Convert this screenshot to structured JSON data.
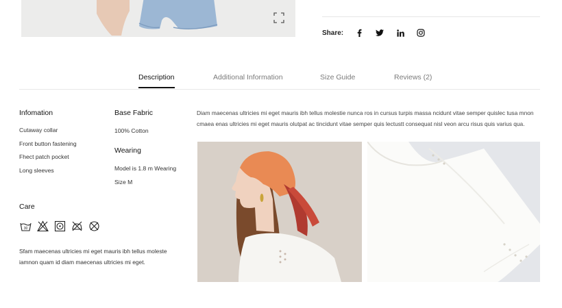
{
  "share": {
    "label": "Share:",
    "icons": [
      "facebook-icon",
      "twitter-icon",
      "linkedin-icon",
      "instagram-icon"
    ]
  },
  "tabs": [
    {
      "label": "Description",
      "active": true
    },
    {
      "label": "Additional Information",
      "active": false
    },
    {
      "label": "Size Guide",
      "active": false
    },
    {
      "label": "Reviews (2)",
      "active": false
    }
  ],
  "info": {
    "title": "Infomation",
    "items": [
      "Cutaway collar",
      "Front button fastening",
      "Fhect patch pocket",
      "Long sleeves"
    ]
  },
  "fabric": {
    "title": "Base Fabric",
    "value": "100% Cotton"
  },
  "wearing": {
    "title": "Wearing",
    "lines": [
      "Model is 1.8 m Wearing",
      "Size M"
    ]
  },
  "care": {
    "title": "Care",
    "icons": [
      "wash-30-icon",
      "no-bleach-icon",
      "tumble-dry-icon",
      "no-iron-icon",
      "no-dryclean-icon"
    ],
    "text": "Sfam maecenas ultricies mi eget mauris ibh tellus moleste iamnon quam id diam maecenas ultricies mi eget."
  },
  "description": "Diam maecenas ultricies mi eget mauris ibh tellus molestie nunca ros in cursus turpis massa ncidunt vitae semper quislec tusa mnon cmaea enas ultricies mi eget mauris olutpat ac tincidunt vitae semper quis lectustt consequat nisl veon arcu risus quis varius qua.",
  "colors": {
    "accent": "#111111",
    "muted": "#7a7a7a",
    "divider": "#e8e8e8",
    "scarf": "#e98a54"
  }
}
